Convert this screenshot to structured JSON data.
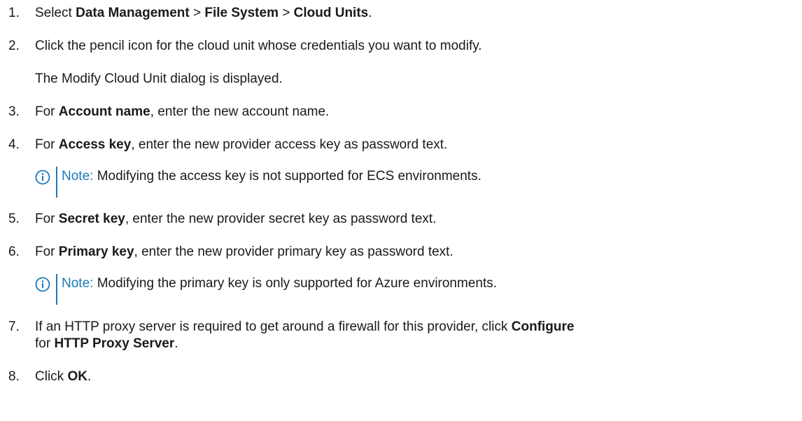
{
  "steps": {
    "s1": {
      "num": "1.",
      "pre": "Select ",
      "b1": "Data Management",
      "sep1": " > ",
      "b2": "File System",
      "sep2": " > ",
      "b3": "Cloud Units",
      "post": "."
    },
    "s2": {
      "num": "2.",
      "text": "Click the pencil icon for the cloud unit whose credentials you want to modify.",
      "followup": "The Modify Cloud Unit dialog is displayed."
    },
    "s3": {
      "num": "3.",
      "pre": "For ",
      "bold": "Account name",
      "post": ", enter the new account name."
    },
    "s4": {
      "num": "4.",
      "pre": "For ",
      "bold": "Access key",
      "post": ", enter the new provider access key as password text."
    },
    "note1": {
      "label": "Note:",
      "text": " Modifying the access key is not supported for ECS environments."
    },
    "s5": {
      "num": "5.",
      "pre": "For ",
      "bold": "Secret key",
      "post": ", enter the new provider secret key as password text."
    },
    "s6": {
      "num": "6.",
      "pre": "For ",
      "bold": "Primary key",
      "post": ", enter the new provider primary key as password text."
    },
    "note2": {
      "label": "Note:",
      "text": " Modifying the primary key is only supported for Azure environments."
    },
    "s7": {
      "num": "7.",
      "pre": "If an HTTP proxy server is required to get around a firewall for this provider, click ",
      "bold1": "Configure",
      "mid": "for ",
      "bold2": "HTTP Proxy Server",
      "post": "."
    },
    "s8": {
      "num": "8.",
      "pre": "Click ",
      "bold": "OK",
      "post": "."
    }
  },
  "colors": {
    "note_accent": "#1a7ab8",
    "text": "#1a1a1a"
  },
  "icons": {
    "note": "info-circle-icon"
  }
}
